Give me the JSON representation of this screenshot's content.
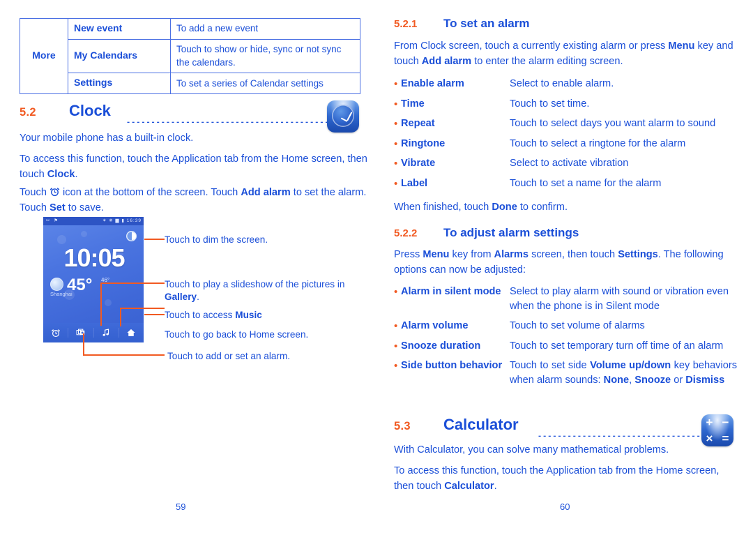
{
  "left": {
    "table": {
      "row_header": "More",
      "rows": [
        {
          "term": "New event",
          "desc": "To add a new event"
        },
        {
          "term": "My Calendars",
          "desc": "Touch to show or hide, sync or not sync the calendars."
        },
        {
          "term": "Settings",
          "desc": "To set a series of Calendar settings"
        }
      ]
    },
    "clock_section": {
      "number": "5.2",
      "title": "Clock",
      "leader": "..................................................",
      "icon": "clock-app-icon",
      "para1": "Your mobile phone has a built-in clock.",
      "para2_a": "To access this function, touch the Application tab from the Home screen, then touch ",
      "para2_b": "Clock",
      "para2_c": ".",
      "para3_a": "Touch ",
      "para3_icon": "alarm-clock-icon",
      "para3_b": " icon at the bottom of the screen. Touch ",
      "para3_c": "Add alarm",
      "para3_d": " to set the alarm. Touch ",
      "para3_e": "Set",
      "para3_f": " to save."
    },
    "phone": {
      "status_left": "✂ ⚑",
      "status_right": "✶ ✵ ▆ ▮ 16:39",
      "time": "10:05",
      "city": "Shanghai",
      "temp_high": "45°",
      "temp_low": "46°",
      "toolbar": [
        "alarm-icon",
        "gallery-icon",
        "music-icon",
        "home-icon"
      ],
      "dim_button": "brightness-icon"
    },
    "callouts": [
      {
        "text": "Touch to dim the screen."
      },
      {
        "text_a": "Touch to play a slideshow of the pictures in ",
        "text_b": "Gallery",
        "text_c": "."
      },
      {
        "text_a": "Touch to access ",
        "text_b": "Music",
        "text_c": ""
      },
      {
        "text": "Touch to go back to Home screen."
      },
      {
        "text": "Touch to add or set an alarm."
      }
    ],
    "page_number": "59"
  },
  "right": {
    "s521": {
      "number": "5.2.1",
      "title": "To set an alarm",
      "intro_a": "From Clock screen, touch a currently existing alarm or press ",
      "intro_b": "Menu",
      "intro_c": " key and touch ",
      "intro_d": "Add alarm",
      "intro_e": " to enter the alarm editing screen.",
      "items": [
        {
          "term": "Enable alarm",
          "desc": "Select to enable alarm."
        },
        {
          "term": "Time",
          "desc": "Touch to set time."
        },
        {
          "term": "Repeat",
          "desc": "Touch to select days you want alarm to sound"
        },
        {
          "term": "Ringtone",
          "desc": "Touch to select a ringtone for the alarm"
        },
        {
          "term": "Vibrate",
          "desc": "Select to activate vibration"
        },
        {
          "term": "Label",
          "desc": "Touch to set a name for the alarm"
        }
      ],
      "closing_a": "When finished, touch ",
      "closing_b": "Done",
      "closing_c": " to confirm."
    },
    "s522": {
      "number": "5.2.2",
      "title": "To adjust alarm settings",
      "intro_a": "Press ",
      "intro_b": "Menu",
      "intro_c": " key from ",
      "intro_d": "Alarms",
      "intro_e": " screen, then touch ",
      "intro_f": "Settings",
      "intro_g": ". The following options can now be adjusted:",
      "items": [
        {
          "term": "Alarm in silent mode",
          "desc": "Select to play alarm with sound or vibration even when the phone is in Silent mode"
        },
        {
          "term": "Alarm volume",
          "desc": "Touch to set volume of alarms"
        },
        {
          "term": "Snooze duration",
          "desc": "Touch to set temporary turn off time of an alarm"
        }
      ],
      "side_button": {
        "term": "Side button behavior",
        "d_a": "Touch to set side ",
        "d_b": "Volume up/down",
        "d_c": " key behaviors when alarm sounds: ",
        "d_d": "None",
        "d_e": ", ",
        "d_f": "Snooze",
        "d_g": " or ",
        "d_h": "Dismiss"
      }
    },
    "s53": {
      "number": "5.3",
      "title": "Calculator",
      "leader": "..........................................",
      "icon": "calculator-app-icon",
      "icon_glyphs": [
        "+",
        "−",
        "×",
        "="
      ],
      "para1": "With Calculator, you can solve many mathematical problems.",
      "para2_a": "To access this function, touch the Application tab from the Home screen, then touch ",
      "para2_b": "Calculator",
      "para2_c": "."
    },
    "page_number": "60"
  },
  "colors": {
    "blue": "#1B4FD8",
    "orange": "#F15A22",
    "table_border": "#4A6FE3"
  }
}
